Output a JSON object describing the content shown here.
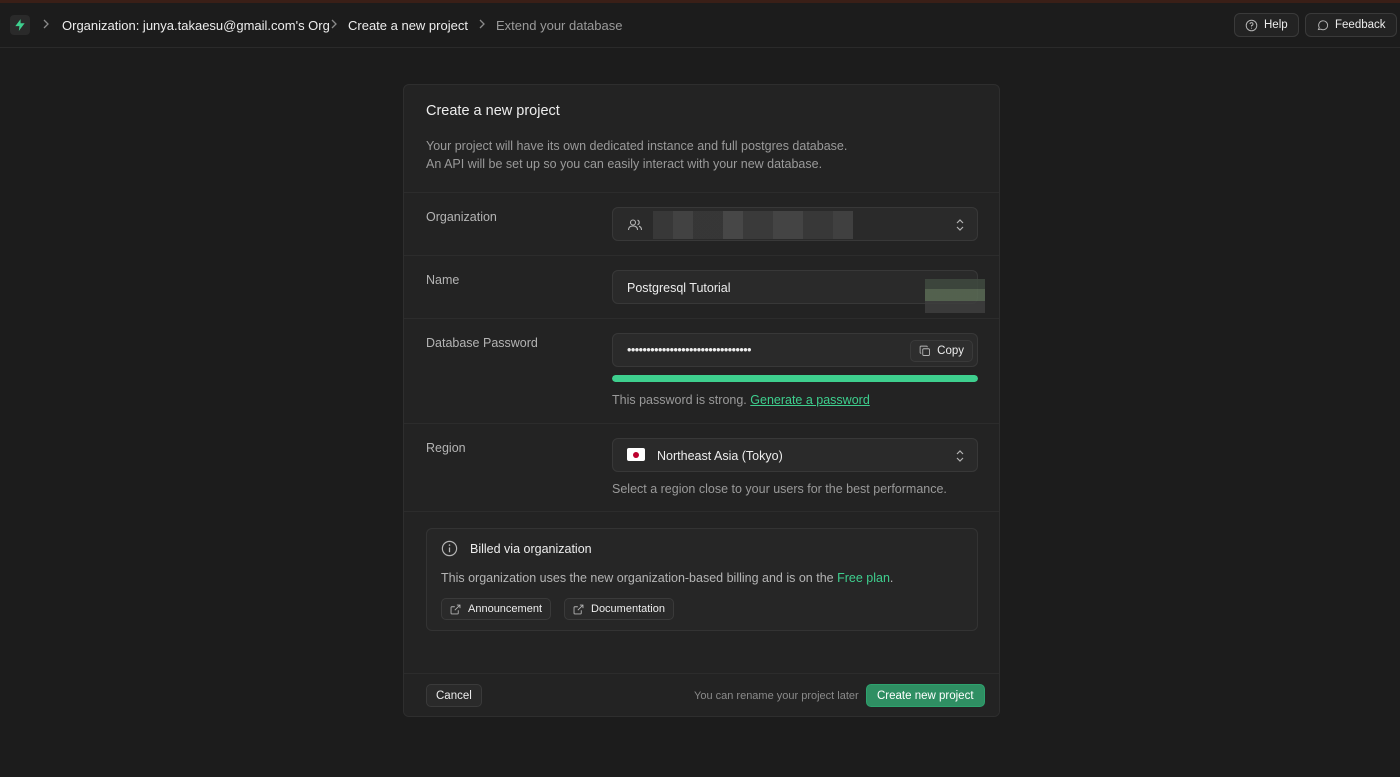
{
  "breadcrumb": {
    "items": [
      {
        "label": "Organization: junya.takaesu@gmail.com's Org"
      },
      {
        "label": "Create a new project"
      },
      {
        "label": "Extend your database"
      }
    ]
  },
  "topbar": {
    "help_label": "Help",
    "feedback_label": "Feedback"
  },
  "form": {
    "title": "Create a new project",
    "description_line1": "Your project will have its own dedicated instance and full postgres database.",
    "description_line2": "An API will be set up so you can easily interact with your new database.",
    "organization": {
      "label": "Organization",
      "value": ""
    },
    "name": {
      "label": "Name",
      "value": "Postgresql Tutorial"
    },
    "password": {
      "label": "Database Password",
      "value": "••••••••••••••••••••••••••••••••",
      "copy_label": "Copy",
      "strength_fraction": 1.0,
      "strength_text": "This password is strong.",
      "generate_label": "Generate a password"
    },
    "region": {
      "label": "Region",
      "value": "Northeast Asia (Tokyo)",
      "helper": "Select a region close to your users for the best performance."
    },
    "billing": {
      "title": "Billed via organization",
      "text_prefix": "This organization uses the new organization-based billing and is on the ",
      "plan_label": "Free plan",
      "text_suffix": ".",
      "announcement_label": "Announcement",
      "documentation_label": "Documentation"
    },
    "footer": {
      "cancel_label": "Cancel",
      "rename_hint": "You can rename your project later",
      "create_label": "Create new project"
    }
  },
  "colors": {
    "background": "#1c1c1c",
    "card": "#232323",
    "brand_green": "#3ecf8e",
    "primary_button": "#2f8f63"
  },
  "icons": {
    "logo": "lightning-bolt-icon",
    "help": "help-circle-icon",
    "feedback": "chat-bubble-icon",
    "organization": "users-icon",
    "copy": "copy-icon",
    "info": "info-icon",
    "external_link": "external-link-icon",
    "select": "chevron-up-down-icon"
  }
}
